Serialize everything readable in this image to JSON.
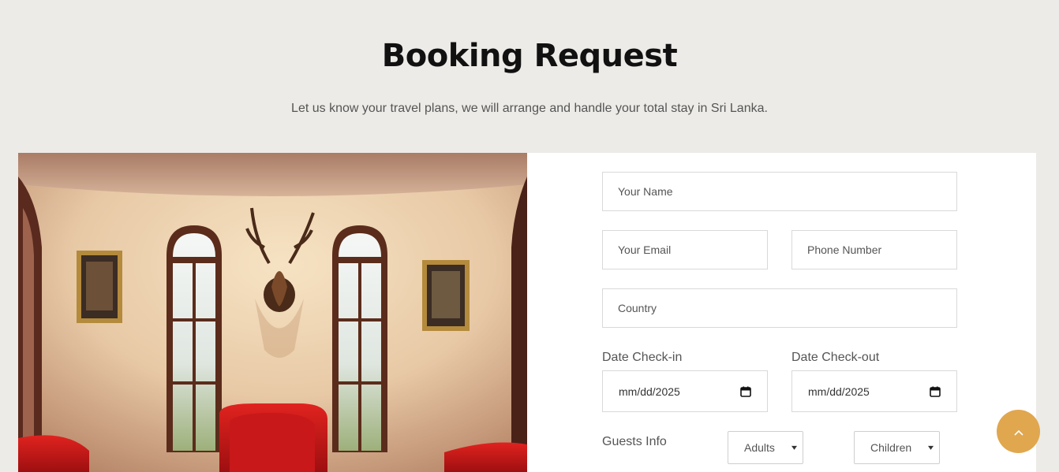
{
  "header": {
    "title": "Booking Request",
    "subtitle": "Let us know your travel plans, we will arrange and handle your total stay in Sri Lanka."
  },
  "form": {
    "name_placeholder": "Your Name",
    "email_placeholder": "Your Email",
    "phone_placeholder": "Phone Number",
    "country_placeholder": "Country",
    "checkin_label": "Date Check-in",
    "checkout_label": "Date Check-out",
    "checkin_value": "mm/dd/2025",
    "checkout_value": "mm/dd/2025",
    "guests_label": "Guests Info",
    "adults_selected": "Adults",
    "children_selected": "Children"
  },
  "icons": {
    "calendar": "calendar-icon",
    "chevron": "chevron-down-icon",
    "scroll_top": "chevron-up-icon"
  },
  "colors": {
    "background": "#ecebe7",
    "accent": "#e0a74f",
    "panel": "#ffffff"
  }
}
